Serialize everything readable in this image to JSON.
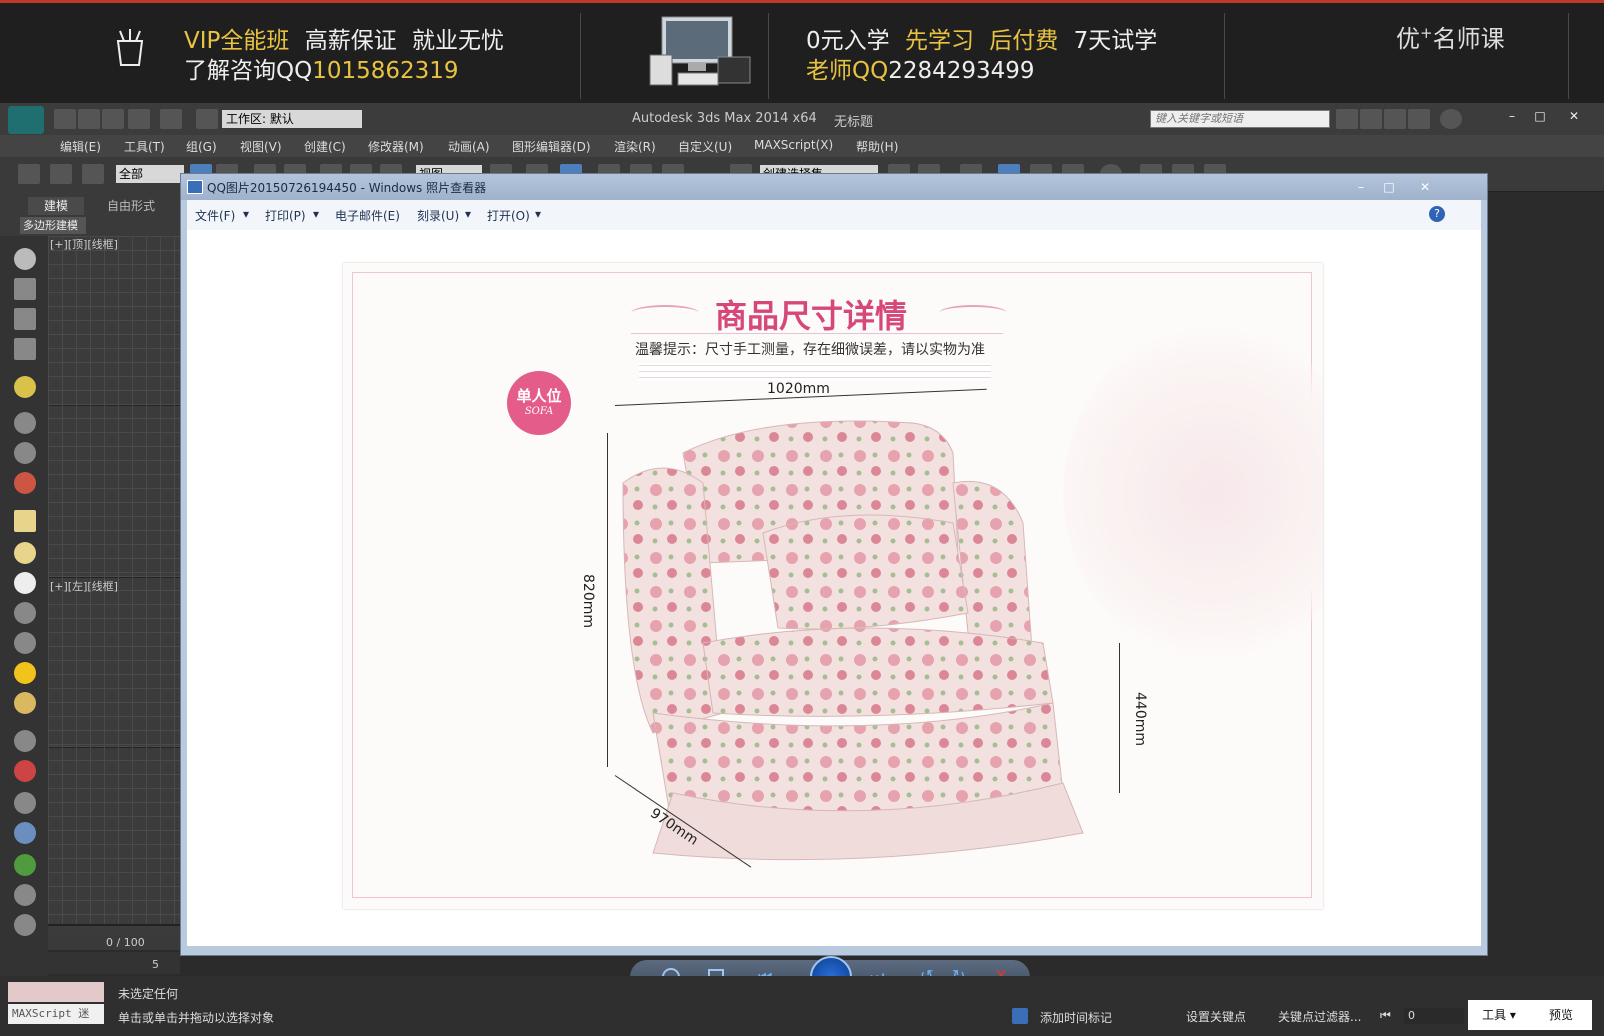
{
  "ad_banner": {
    "left_line1_a": "VIP全能班",
    "left_line1_b": "高薪保证",
    "left_line1_c": "就业无忧",
    "left_line2_a": "了解咨询QQ",
    "left_line2_b": "1015862319",
    "mid_line1_a": "0元入学",
    "mid_line1_b": "先学习",
    "mid_line1_c": "后付费",
    "mid_line1_d": "7天试学",
    "mid_line2_a": "老师QQ",
    "mid_line2_b": "2284293499",
    "brand_a": "优",
    "brand_plus": "+",
    "brand_b": "名师课"
  },
  "max": {
    "title": "Autodesk 3ds Max  2014 x64",
    "doc": "无标题",
    "workspace_label": "工作区: 默认",
    "search_placeholder": "键入关键字或短语",
    "menu": [
      "编辑(E)",
      "工具(T)",
      "组(G)",
      "视图(V)",
      "创建(C)",
      "修改器(M)",
      "动画(A)",
      "图形编辑器(D)",
      "渲染(R)",
      "自定义(U)",
      "MAXScript(X)",
      "帮助(H)"
    ],
    "selection_filter": "全部",
    "ref_coord": "视图",
    "named_selection": "创建选择集",
    "ribbon_tabs": [
      "建模",
      "自由形式"
    ],
    "ribbon_sub": "多边形建模",
    "vp1_label": "[+][顶][线框]",
    "vp2_label": "[+][左][线框]",
    "time_slider": "0 / 100",
    "track_tick": "5",
    "status_sel": "未选定任何",
    "prompt": "单击或单击并拖动以选择对象",
    "maxscript_label": "MAXScript 迷",
    "add_time_tag": "添加时间标记",
    "set_key": "设置关键点",
    "key_filter": "关键点过滤器...",
    "frame": "0",
    "tools_menu": "工具",
    "preview": "预览"
  },
  "viewer": {
    "title": "QQ图片20150726194450 - Windows 照片查看器",
    "menu": [
      "文件(F)",
      "打印(P)",
      "电子邮件(E)",
      "刻录(U)",
      "打开(O)"
    ],
    "photo": {
      "heading": "商品尺寸详情",
      "tip": "温馨提示：尺寸手工测量，存在细微误差，请以实物为准",
      "badge_cn": "单人位",
      "badge_en": "SOFA",
      "width": "1020mm",
      "height": "820mm",
      "seat": "440mm",
      "depth": "970mm"
    }
  },
  "colors": {
    "accent_yellow": "#e8c341",
    "heading_pink": "#d6477a",
    "badge_pink": "#e45c8a",
    "close_red": "#d23b3b"
  }
}
